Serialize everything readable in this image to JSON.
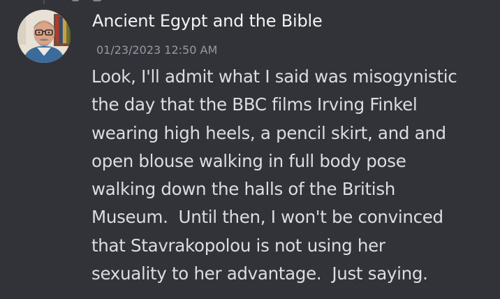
{
  "message": {
    "author": "Ancient Egypt and the Bible",
    "timestamp": "01/23/2023 12:50 AM",
    "avatar_icon": "user-avatar-portrait-icon",
    "lines": [
      "Look, I'll admit what I said was misogynistic",
      "the day that the BBC films Irving Finkel",
      "wearing high heels, a pencil skirt, and and",
      "open blouse walking in full body pose",
      "walking down the halls of the British",
      "Museum.  Until then, I won't be convinced",
      "that Stavrakopolou is not using her",
      "sexuality to her advantage.  Just saying."
    ]
  },
  "colors": {
    "background": "#313338",
    "author_text": "#f2f3f5",
    "timestamp_text": "#949ba4",
    "body_text": "#dbdee1"
  }
}
